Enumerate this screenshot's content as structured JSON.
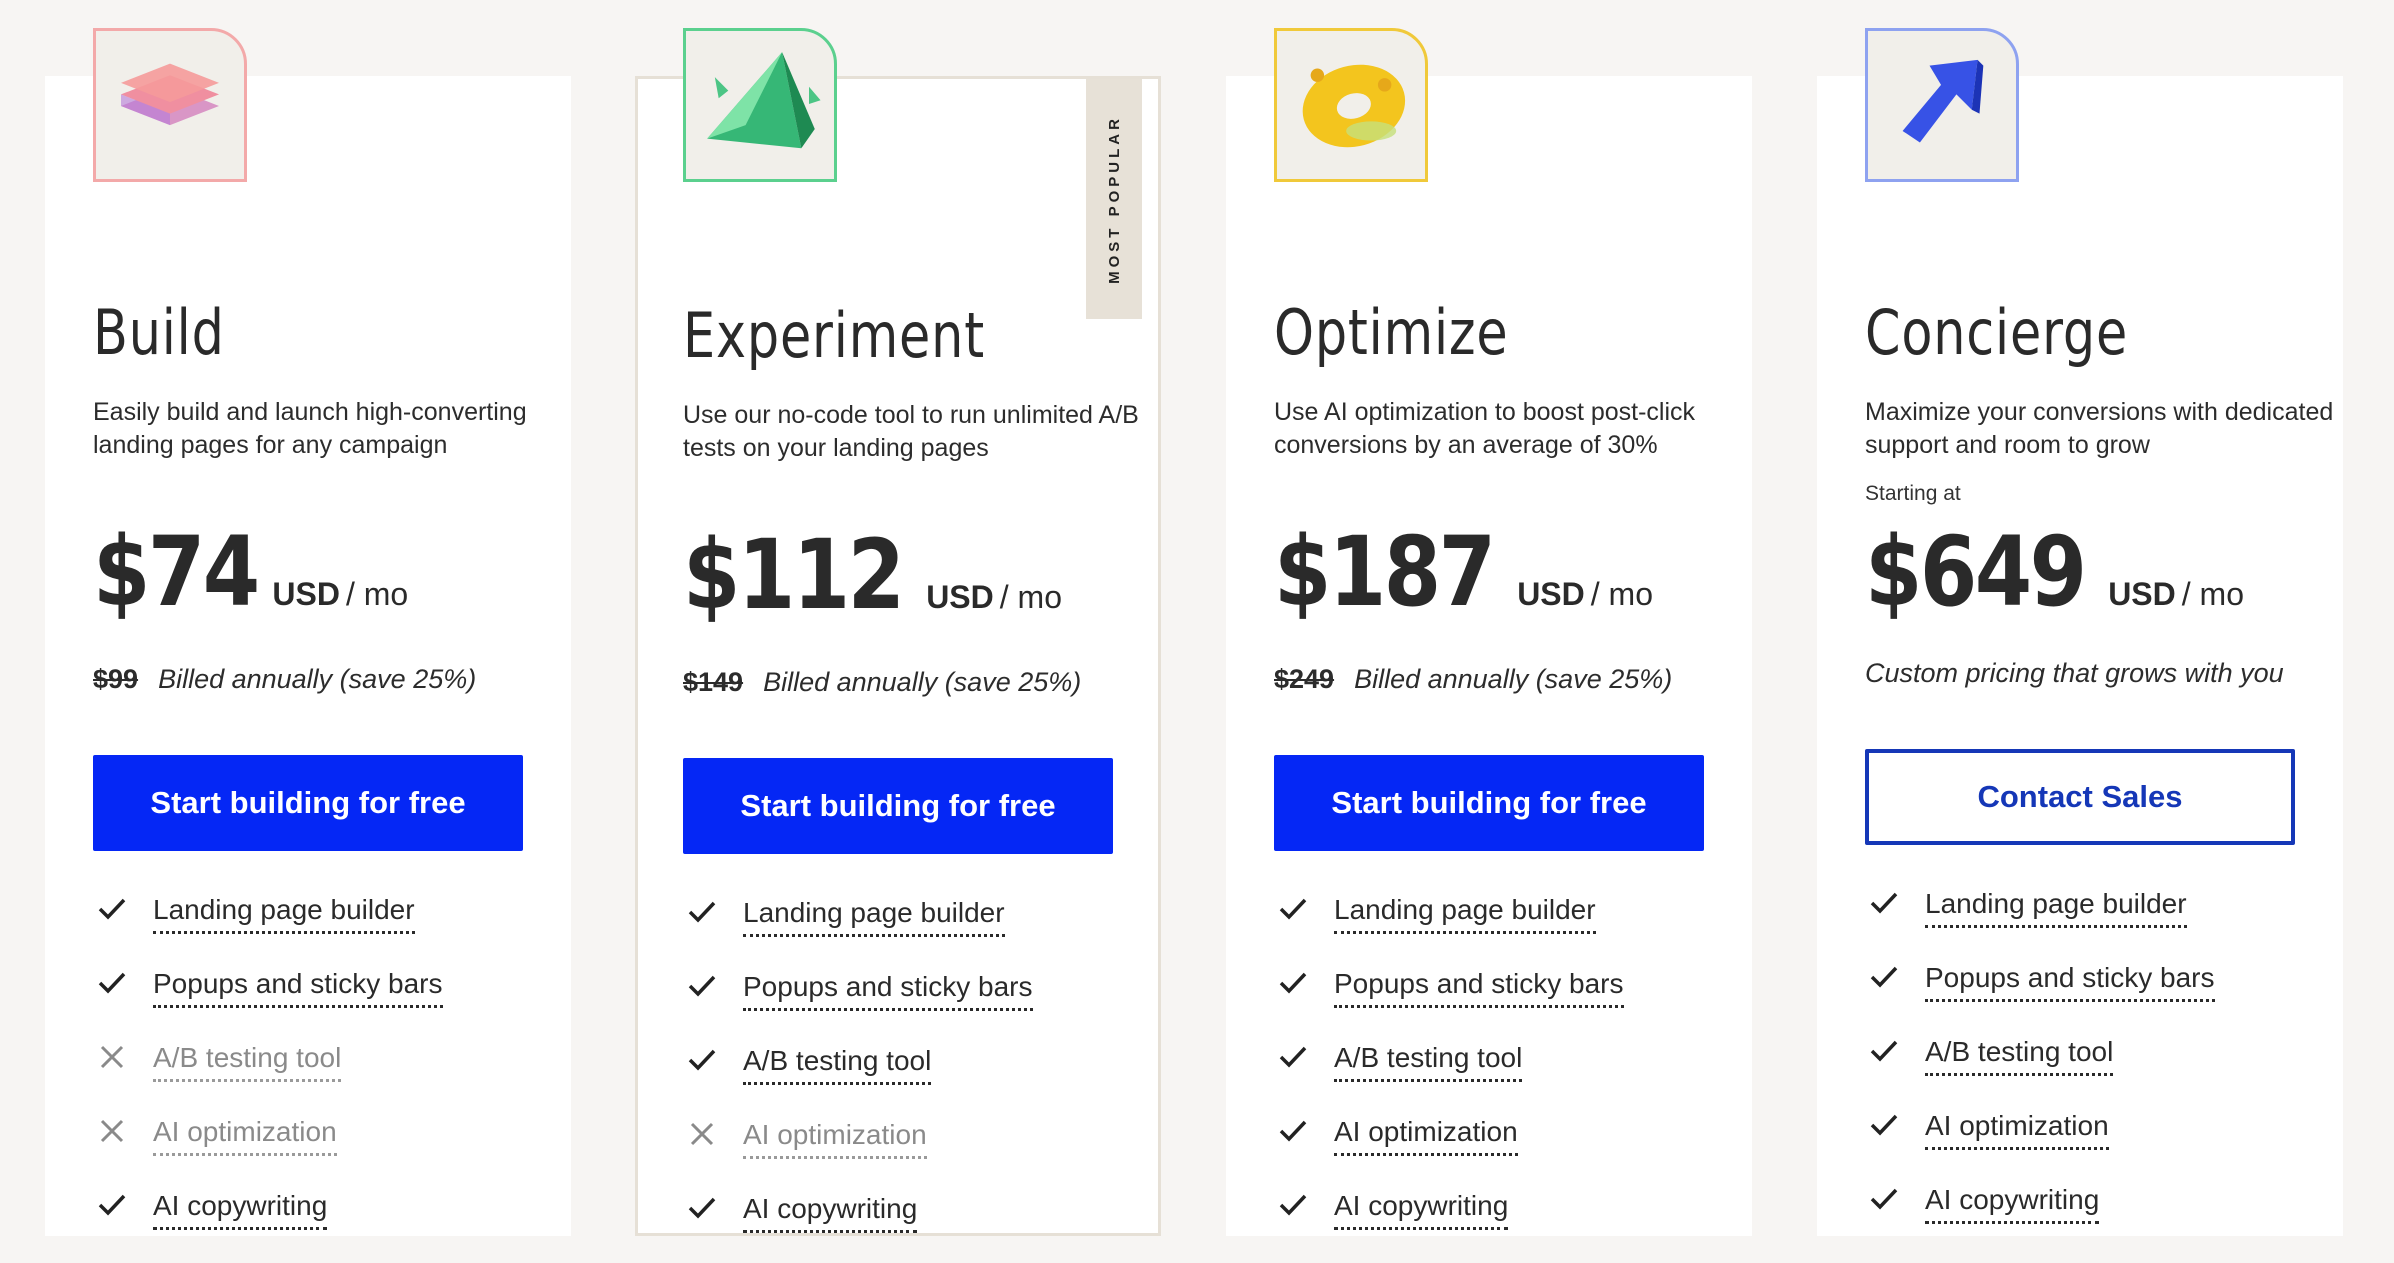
{
  "plans": [
    {
      "name": "Build",
      "description": "Easily build and launch high-converting landing pages for any campaign",
      "price": "$74",
      "currency": "USD",
      "period": "/ mo",
      "old_price": "$99",
      "billing_note": "Billed annually (save 25%)",
      "cta_label": "Start building for free",
      "icon": "layers-icon",
      "icon_color": "#f29a9a",
      "features": [
        {
          "label": "Landing page builder",
          "included": true
        },
        {
          "label": "Popups and sticky bars",
          "included": true
        },
        {
          "label": "A/B testing tool",
          "included": false
        },
        {
          "label": "AI optimization",
          "included": false
        },
        {
          "label": "AI copywriting",
          "included": true
        }
      ]
    },
    {
      "name": "Experiment",
      "description": "Use our no-code tool to run unlimited A/B tests on your landing pages",
      "price": "$112",
      "currency": "USD",
      "period": "/ mo",
      "old_price": "$149",
      "billing_note": "Billed annually (save 25%)",
      "cta_label": "Start building for free",
      "badge": "MOST POPULAR",
      "icon": "pyramid-icon",
      "icon_color": "#5bd08e",
      "features": [
        {
          "label": "Landing page builder",
          "included": true
        },
        {
          "label": "Popups and sticky bars",
          "included": true
        },
        {
          "label": "A/B testing tool",
          "included": true
        },
        {
          "label": "AI optimization",
          "included": false
        },
        {
          "label": "AI copywriting",
          "included": true
        }
      ]
    },
    {
      "name": "Optimize",
      "description": "Use AI optimization to boost post-click conversions by an average of 30%",
      "price": "$187",
      "currency": "USD",
      "period": "/ mo",
      "old_price": "$249",
      "billing_note": "Billed annually (save 25%)",
      "cta_label": "Start building for free",
      "icon": "ring-icon",
      "icon_color": "#f0c93a",
      "features": [
        {
          "label": "Landing page builder",
          "included": true
        },
        {
          "label": "Popups and sticky bars",
          "included": true
        },
        {
          "label": "A/B testing tool",
          "included": true
        },
        {
          "label": "AI optimization",
          "included": true
        },
        {
          "label": "AI copywriting",
          "included": true
        }
      ]
    },
    {
      "name": "Concierge",
      "description": "Maximize your conversions with dedicated support and room to grow",
      "starting_label": "Starting at",
      "price": "$649",
      "currency": "USD",
      "period": "/ mo",
      "billing_note": "Custom pricing that grows with you",
      "cta_label": "Contact Sales",
      "icon": "arrow-icon",
      "icon_color": "#8ea2f0",
      "features": [
        {
          "label": "Landing page builder",
          "included": true
        },
        {
          "label": "Popups and sticky bars",
          "included": true
        },
        {
          "label": "A/B testing tool",
          "included": true
        },
        {
          "label": "AI optimization",
          "included": true
        },
        {
          "label": "AI copywriting",
          "included": true
        }
      ]
    }
  ],
  "colors": {
    "primary": "#0527f5",
    "outline": "#1537b7",
    "background": "#f7f5f3",
    "badge_bg": "#e7e1d7"
  }
}
